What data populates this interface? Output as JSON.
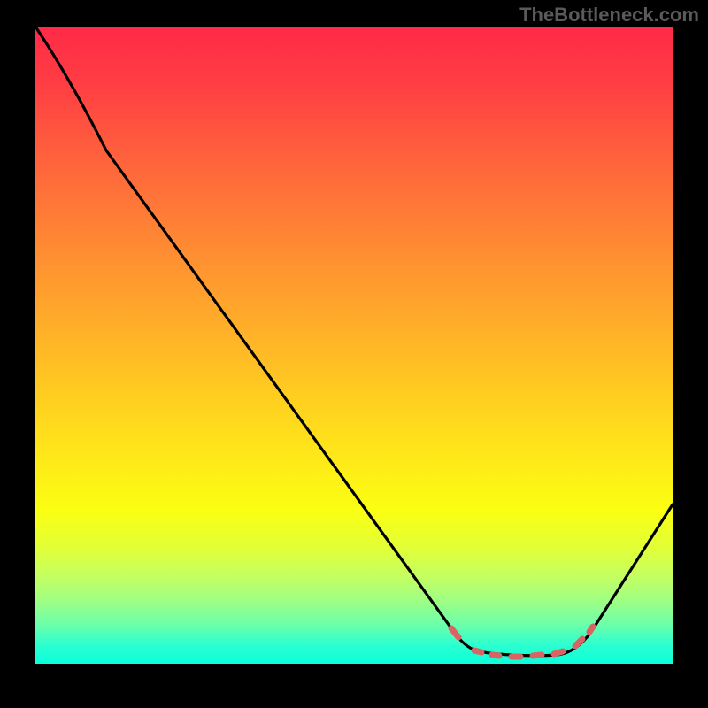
{
  "watermark": "TheBottleneck.com",
  "colors": {
    "gradient_top": "#ff2a47",
    "gradient_mid": "#ffe41a",
    "gradient_bottom": "#0affda",
    "curve": "#000000",
    "marker": "#d86464",
    "frame": "#000000",
    "watermark_text": "#5a5a5a"
  },
  "chart_data": {
    "type": "line",
    "title": "",
    "xlabel": "",
    "ylabel": "",
    "xlim": [
      0,
      100
    ],
    "ylim": [
      0,
      100
    ],
    "grid": false,
    "legend": false,
    "series": [
      {
        "name": "bottleneck-curve",
        "x": [
          0,
          5,
          10,
          15,
          20,
          25,
          30,
          35,
          40,
          45,
          50,
          55,
          60,
          64,
          68,
          72,
          76,
          80,
          82,
          84,
          86,
          88,
          92,
          96,
          100
        ],
        "values": [
          100,
          94,
          88,
          81,
          74,
          67,
          60,
          53,
          46,
          39,
          32,
          25,
          18,
          12,
          7,
          4,
          2,
          1,
          1,
          1,
          2,
          4,
          9,
          16,
          24
        ]
      }
    ],
    "annotations": [
      {
        "name": "optimal-region",
        "style": "dashed-red-markers",
        "x_range": [
          64,
          88
        ],
        "y_approx": 1
      }
    ],
    "background": {
      "type": "vertical-gradient",
      "description": "red (high) through orange/yellow to green (low)"
    }
  }
}
